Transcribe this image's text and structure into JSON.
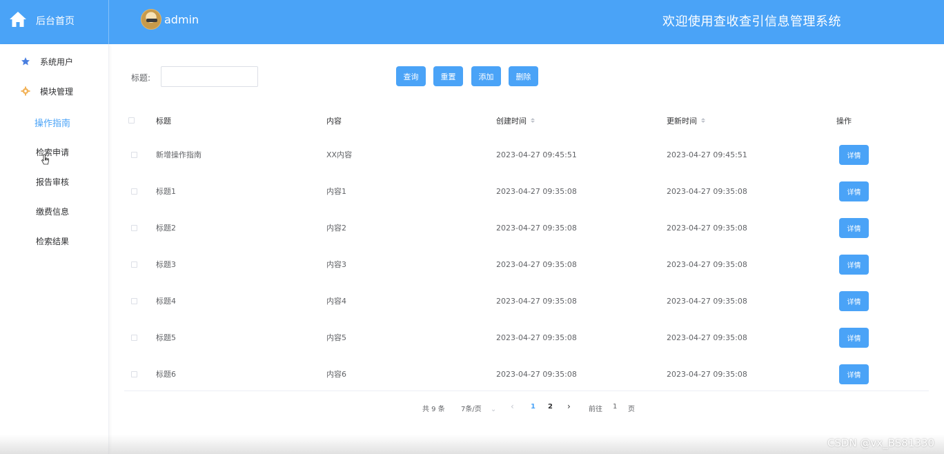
{
  "header": {
    "brand_label": "后台首页",
    "username": "admin",
    "system_title": "欢迎使用查收查引信息管理系统",
    "accent_color": "#4aa3f7"
  },
  "sidebar": {
    "items": [
      {
        "label": "系统用户",
        "icon": "star-icon"
      },
      {
        "label": "模块管理",
        "icon": "gear-icon"
      }
    ],
    "sub_items": [
      {
        "label": "操作指南",
        "active": true
      },
      {
        "label": "检索申请"
      },
      {
        "label": "报告审核"
      },
      {
        "label": "缴费信息"
      },
      {
        "label": "检索结果"
      }
    ]
  },
  "search": {
    "label": "标题:",
    "value": "",
    "placeholder": ""
  },
  "toolbar": {
    "query_label": "查询",
    "reset_label": "重置",
    "add_label": "添加",
    "delete_label": "删除"
  },
  "table": {
    "columns": [
      "标题",
      "内容",
      "创建时间",
      "更新时间",
      "操作"
    ],
    "rows": [
      {
        "title": "新增操作指南",
        "content": "XX内容",
        "created": "2023-04-27 09:45:51",
        "updated": "2023-04-27 09:45:51",
        "action": "详情"
      },
      {
        "title": "标题1",
        "content": "内容1",
        "created": "2023-04-27 09:35:08",
        "updated": "2023-04-27 09:35:08",
        "action": "详情"
      },
      {
        "title": "标题2",
        "content": "内容2",
        "created": "2023-04-27 09:35:08",
        "updated": "2023-04-27 09:35:08",
        "action": "详情"
      },
      {
        "title": "标题3",
        "content": "内容3",
        "created": "2023-04-27 09:35:08",
        "updated": "2023-04-27 09:35:08",
        "action": "详情"
      },
      {
        "title": "标题4",
        "content": "内容4",
        "created": "2023-04-27 09:35:08",
        "updated": "2023-04-27 09:35:08",
        "action": "详情"
      },
      {
        "title": "标题5",
        "content": "内容5",
        "created": "2023-04-27 09:35:08",
        "updated": "2023-04-27 09:35:08",
        "action": "详情"
      },
      {
        "title": "标题6",
        "content": "内容6",
        "created": "2023-04-27 09:35:08",
        "updated": "2023-04-27 09:35:08",
        "action": "详情"
      }
    ]
  },
  "pagination": {
    "total": "共 9 条",
    "page_size": "7条/页",
    "pages": [
      "1",
      "2"
    ],
    "current_page": "1",
    "goto_prefix": "前往",
    "goto_value": "1",
    "goto_suffix": "页"
  },
  "watermark": "CSDN @vx_BS81330"
}
